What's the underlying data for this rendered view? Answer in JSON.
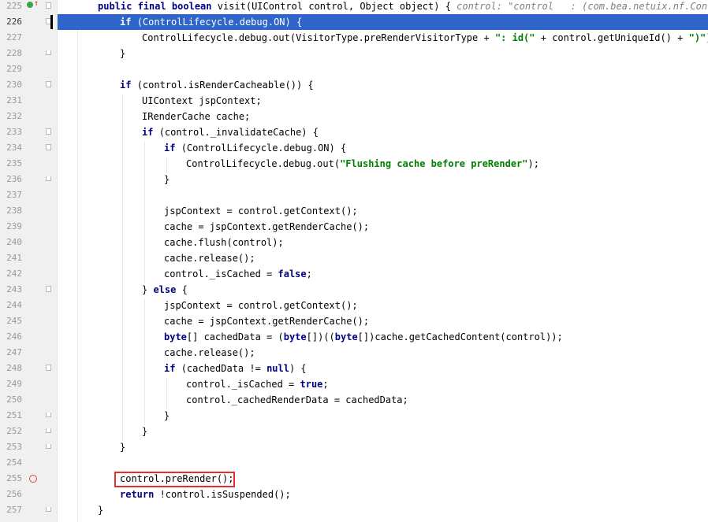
{
  "gutter": {
    "line_numbers": [
      "225",
      "226",
      "227",
      "228",
      "229",
      "230",
      "231",
      "232",
      "233",
      "234",
      "235",
      "236",
      "237",
      "238",
      "239",
      "240",
      "241",
      "242",
      "243",
      "244",
      "245",
      "246",
      "247",
      "248",
      "249",
      "250",
      "251",
      "252",
      "253",
      "254",
      "255",
      "256",
      "257"
    ]
  },
  "code": {
    "l225": {
      "kw1": "public final boolean ",
      "rest": "visit(UIControl control, Object object) {",
      "hint": "control: \"control   : (com.bea.netuix.nf.Control"
    },
    "l226": {
      "kw1": "if ",
      "rest": "(ControlLifecycle.debug.ON) {"
    },
    "l227": {
      "a": "ControlLifecycle.debug.out(VisitorType.preRenderVisitorType + ",
      "s1": "\": id(\"",
      "b": " + control.getUniqueId() + ",
      "s2": "\")\"",
      "c": ");"
    },
    "l228": {
      "text": "}"
    },
    "l230": {
      "kw1": "if ",
      "rest": "(control.isRenderCacheable()) {"
    },
    "l231": {
      "text": "UIContext jspContext;"
    },
    "l232": {
      "text": "IRenderCache cache;"
    },
    "l233": {
      "kw1": "if ",
      "rest": "(control._invalidateCache) {"
    },
    "l234": {
      "kw1": "if ",
      "rest": "(ControlLifecycle.debug.ON) {"
    },
    "l235": {
      "a": "ControlLifecycle.debug.out(",
      "s1": "\"Flushing cache before preRender\"",
      "c": ");"
    },
    "l236": {
      "text": "}"
    },
    "l238": {
      "text": "jspContext = control.getContext();"
    },
    "l239": {
      "text": "cache = jspContext.getRenderCache();"
    },
    "l240": {
      "text": "cache.flush(control);"
    },
    "l241": {
      "text": "cache.release();"
    },
    "l242": {
      "a": "control._isCached = ",
      "kw1": "false",
      "c": ";"
    },
    "l243": {
      "a": "} ",
      "kw1": "else",
      "c": " {"
    },
    "l244": {
      "text": "jspContext = control.getContext();"
    },
    "l245": {
      "text": "cache = jspContext.getRenderCache();"
    },
    "l246": {
      "kw1": "byte",
      "a": "[] cachedData = (",
      "kw2": "byte",
      "b": "[])((",
      "kw3": "byte",
      "c": "[])cache.getCachedContent(control));"
    },
    "l247": {
      "text": "cache.release();"
    },
    "l248": {
      "kw1": "if ",
      "a": "(cachedData != ",
      "kw2": "null",
      "c": ") {"
    },
    "l249": {
      "a": "control._isCached = ",
      "kw1": "true",
      "c": ";"
    },
    "l250": {
      "text": "control._cachedRenderData = cachedData;"
    },
    "l251": {
      "text": "}"
    },
    "l252": {
      "text": "}"
    },
    "l253": {
      "text": "}"
    },
    "l255": {
      "text": "control.preRender();"
    },
    "l256": {
      "kw1": "return ",
      "rest": "!control.isSuspended();"
    },
    "l257": {
      "text": "}"
    }
  }
}
